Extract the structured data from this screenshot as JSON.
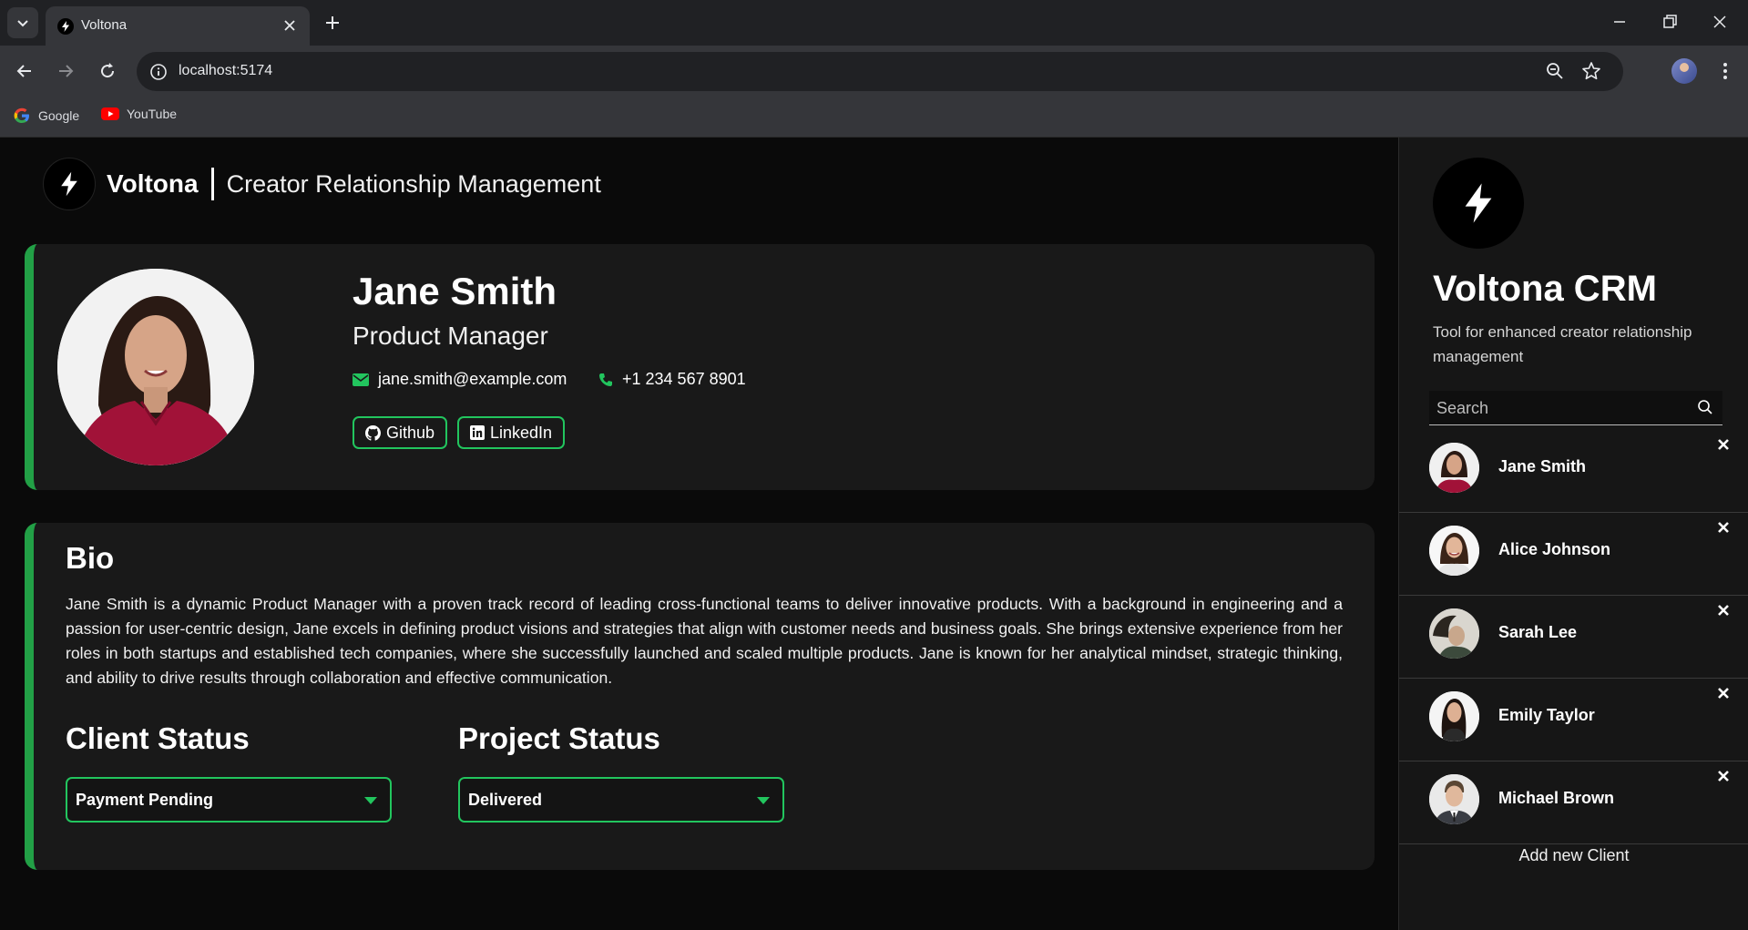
{
  "browser": {
    "tab_title": "Voltona",
    "url": "localhost:5174",
    "bookmarks": [
      {
        "label": "Google",
        "icon": "google-icon"
      },
      {
        "label": "YouTube",
        "icon": "youtube-icon"
      }
    ]
  },
  "header": {
    "brand": "Voltona",
    "tagline": "Creator Relationship Management"
  },
  "profile": {
    "name": "Jane Smith",
    "role": "Product Manager",
    "email": "jane.smith@example.com",
    "phone": "+1 234 567 8901",
    "github_label": "Github",
    "linkedin_label": "LinkedIn"
  },
  "bio": {
    "title": "Bio",
    "text": "Jane Smith is a dynamic Product Manager with a proven track record of leading cross-functional teams to deliver innovative products. With a background in engineering and a passion for user-centric design, Jane excels in defining product visions and strategies that align with customer needs and business goals. She brings extensive experience from her roles in both startups and established tech companies, where she successfully launched and scaled multiple products. Jane is known for her analytical mindset, strategic thinking, and ability to drive results through collaboration and effective communication."
  },
  "client_status": {
    "title": "Client Status",
    "selected": "Payment Pending"
  },
  "project_status": {
    "title": "Project Status",
    "selected": "Delivered"
  },
  "sidebar": {
    "title": "Voltona CRM",
    "subtitle": "Tool for enhanced creator relationship management",
    "search_placeholder": "Search",
    "clients": [
      {
        "name": "Jane Smith"
      },
      {
        "name": "Alice Johnson"
      },
      {
        "name": "Sarah Lee"
      },
      {
        "name": "Emily Taylor"
      },
      {
        "name": "Michael Brown"
      }
    ],
    "add_label": "Add new Client"
  },
  "colors": {
    "accent": "#22c55e",
    "accent_border": "#22a046",
    "background": "#0a0a0a",
    "card": "#191919",
    "sidebar": "#161616"
  }
}
